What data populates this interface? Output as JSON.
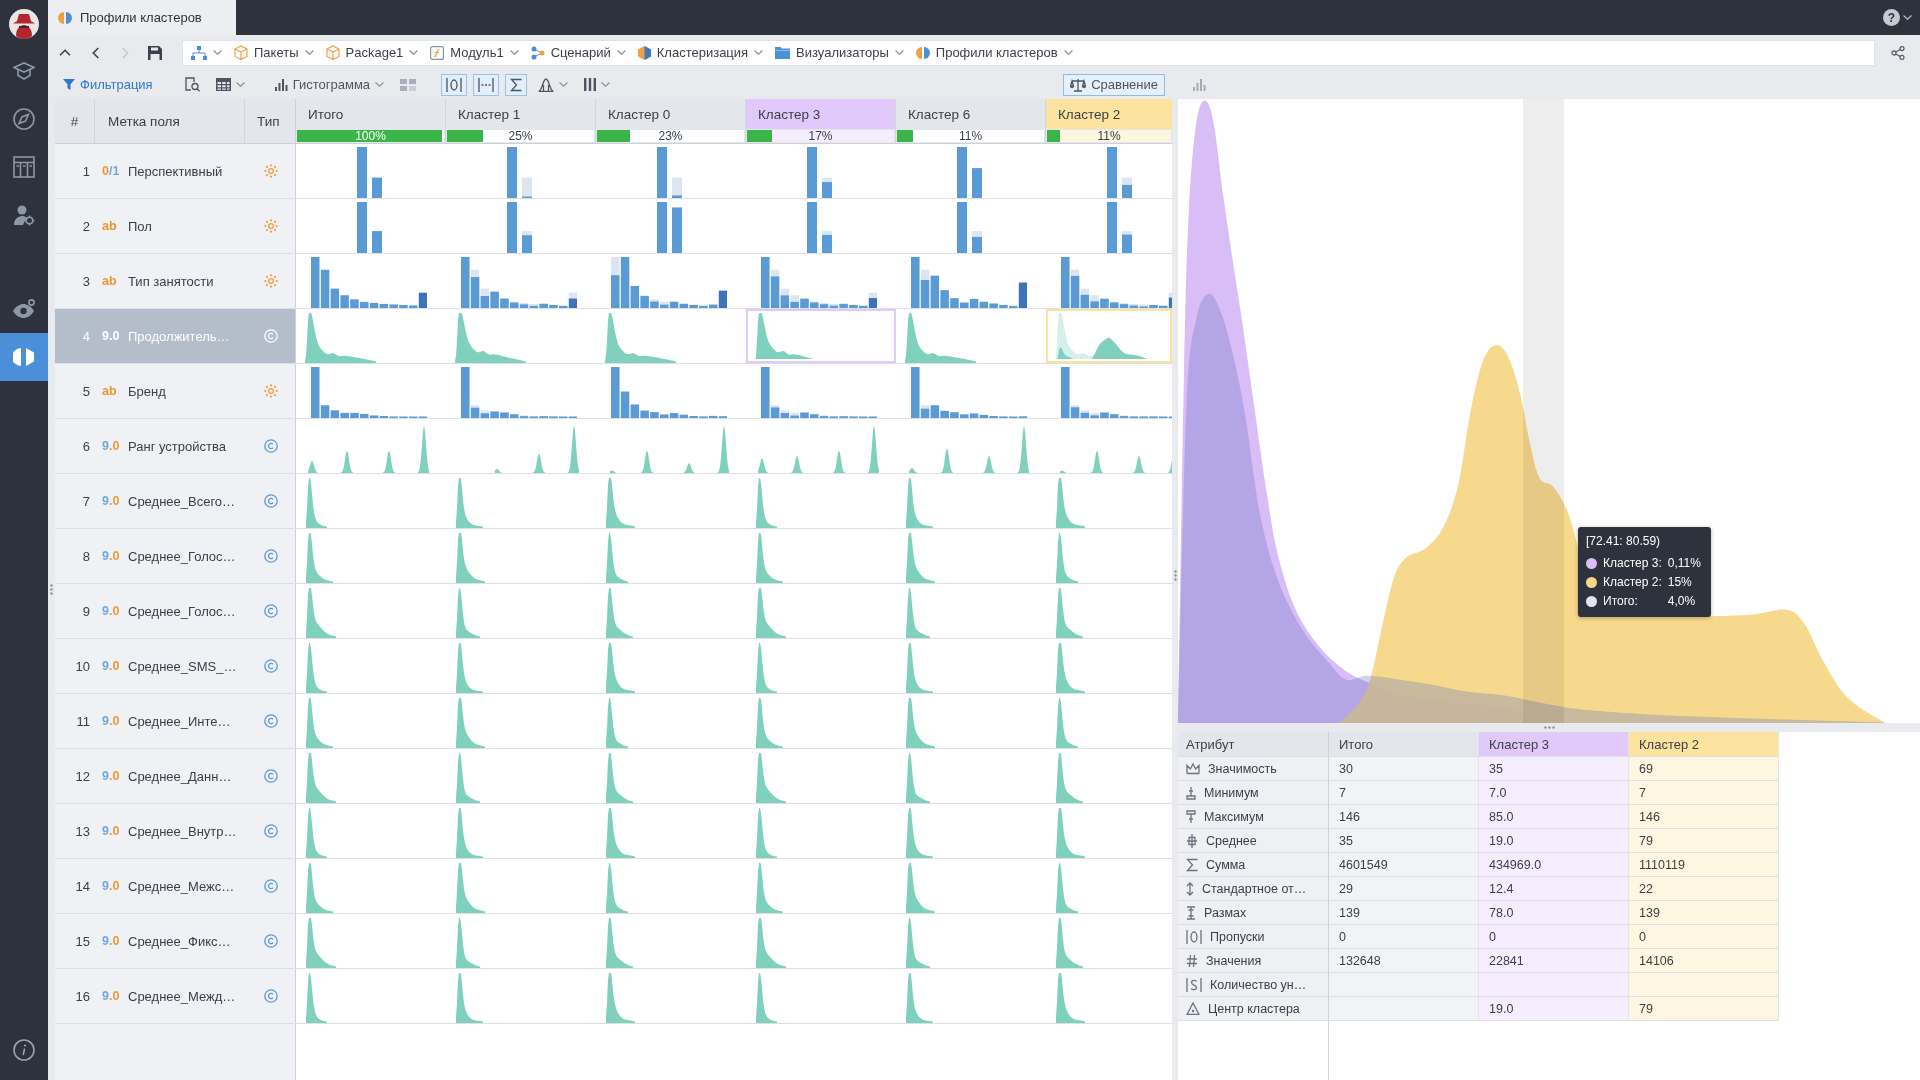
{
  "window": {
    "tab": "Профили кластеров",
    "help": "?"
  },
  "sidebar": {
    "items": [
      {
        "selected": false
      },
      {
        "selected": false
      },
      {
        "selected": false
      },
      {
        "selected": false
      },
      {
        "selected": false
      },
      {
        "selected": true
      }
    ]
  },
  "navigation": [
    {
      "disabled": false
    },
    {
      "disabled": false
    },
    {
      "disabled": true
    },
    {
      "disabled": false
    }
  ],
  "breadcrumb": [
    {
      "label": "Пакеты"
    },
    {
      "label": "Package1"
    },
    {
      "label": "Модуль1"
    },
    {
      "label": "Сценарий"
    },
    {
      "label": "Кластеризация"
    },
    {
      "label": "Визуализаторы"
    },
    {
      "label": "Профили кластеров"
    }
  ],
  "toolbar": {
    "filter": "Фильтрация",
    "view": "Гистограмма",
    "toggles": [
      {
        "on": true
      },
      {
        "on": true
      },
      {
        "on": true
      },
      {
        "on": false
      },
      {
        "on": false
      }
    ],
    "compare": {
      "label": "Сравнение",
      "on": true
    }
  },
  "table": {
    "headers": [
      "#",
      "Метка поля",
      "Тип"
    ],
    "columns": [
      {
        "label": "Итого",
        "share": "100%",
        "level": 1
      },
      {
        "label": "Кластер 1",
        "share": "25%",
        "level": 0.25
      },
      {
        "label": "Кластер 0",
        "share": "23%",
        "level": 0.23
      },
      {
        "label": "Кластер 3",
        "share": "17%",
        "level": 0.17,
        "color": "#e2c9fb"
      },
      {
        "label": "Кластер 6",
        "share": "11%",
        "level": 0.11
      },
      {
        "label": "Кластер 2",
        "share": "11%",
        "level": 0.11,
        "color": "#fde3a0"
      }
    ],
    "rows": [
      {
        "number": "1",
        "badge": "0/1",
        "label": "Перспективный",
        "kind": "binary",
        "selected": false
      },
      {
        "number": "2",
        "badge": "ab",
        "label": "Пол",
        "kind": "string",
        "selected": false
      },
      {
        "number": "3",
        "badge": "ab",
        "label": "Тип занятости",
        "kind": "string",
        "selected": false
      },
      {
        "number": "4",
        "badge": "9.0",
        "label": "Продолжитель…",
        "kind": "number",
        "selected": true
      },
      {
        "number": "5",
        "badge": "ab",
        "label": "Бренд",
        "kind": "string",
        "selected": false
      },
      {
        "number": "6",
        "badge": "9.0",
        "label": "Ранг устройства",
        "kind": "number",
        "selected": false
      },
      {
        "number": "7",
        "badge": "9.0",
        "label": "Среднее_Всего…",
        "kind": "number",
        "selected": false
      },
      {
        "number": "8",
        "badge": "9.0",
        "label": "Среднее_Голос…",
        "kind": "number",
        "selected": false
      },
      {
        "number": "9",
        "badge": "9.0",
        "label": "Среднее_Голос…",
        "kind": "number",
        "selected": false
      },
      {
        "number": "10",
        "badge": "9.0",
        "label": "Среднее_SMS_…",
        "kind": "number",
        "selected": false
      },
      {
        "number": "11",
        "badge": "9.0",
        "label": "Среднее_Инте…",
        "kind": "number",
        "selected": false
      },
      {
        "number": "12",
        "badge": "9.0",
        "label": "Среднее_Данн…",
        "kind": "number",
        "selected": false
      },
      {
        "number": "13",
        "badge": "9.0",
        "label": "Среднее_Внутр…",
        "kind": "number",
        "selected": false
      },
      {
        "number": "14",
        "badge": "9.0",
        "label": "Среднее_Межс…",
        "kind": "number",
        "selected": false
      },
      {
        "number": "15",
        "badge": "9.0",
        "label": "Среднее_Фикс…",
        "kind": "number",
        "selected": false
      },
      {
        "number": "16",
        "badge": "9.0",
        "label": "Среднее_Межд…",
        "kind": "number",
        "selected": false
      }
    ]
  },
  "comparison": {
    "tooltip": {
      "range": "[72.41: 80.59)",
      "items": [
        {
          "label": "Кластер 3:",
          "value": "0,11%",
          "color": "#d8bdf6"
        },
        {
          "label": "Кластер 2:",
          "value": "15%",
          "color": "#f6d684"
        },
        {
          "label": "Итого:",
          "value": "4,0%",
          "color": "#dde5ef"
        }
      ]
    },
    "stats": {
      "attribute_header": "Атрибут",
      "total_header": "Итого",
      "clusters": [
        {
          "label": "Кластер 3",
          "color": "#e2c9fb"
        },
        {
          "label": "Кластер 2",
          "color": "#fde3a0"
        }
      ],
      "rows": [
        {
          "attribute": "Значимость",
          "total": "30",
          "clusters": [
            "35",
            "69"
          ]
        },
        {
          "attribute": "Минимум",
          "total": "7",
          "clusters": [
            "7.0",
            "7"
          ]
        },
        {
          "attribute": "Максимум",
          "total": "146",
          "clusters": [
            "85.0",
            "146"
          ]
        },
        {
          "attribute": "Среднее",
          "total": "35",
          "clusters": [
            "19.0",
            "79"
          ]
        },
        {
          "attribute": "Сумма",
          "total": "4601549",
          "clusters": [
            "434969.0",
            "1110119"
          ]
        },
        {
          "attribute": "Стандартное от…",
          "total": "29",
          "clusters": [
            "12.4",
            "22"
          ]
        },
        {
          "attribute": "Размах",
          "total": "139",
          "clusters": [
            "78.0",
            "139"
          ]
        },
        {
          "attribute": "Пропуски",
          "total": "0",
          "clusters": [
            "0",
            "0"
          ]
        },
        {
          "attribute": "Значения",
          "total": "132648",
          "clusters": [
            "22841",
            "14106"
          ]
        },
        {
          "attribute": "Количество ун…"
        },
        {
          "attribute": "Центр кластера",
          "clusters": [
            "19.0",
            "79"
          ]
        }
      ]
    }
  }
}
